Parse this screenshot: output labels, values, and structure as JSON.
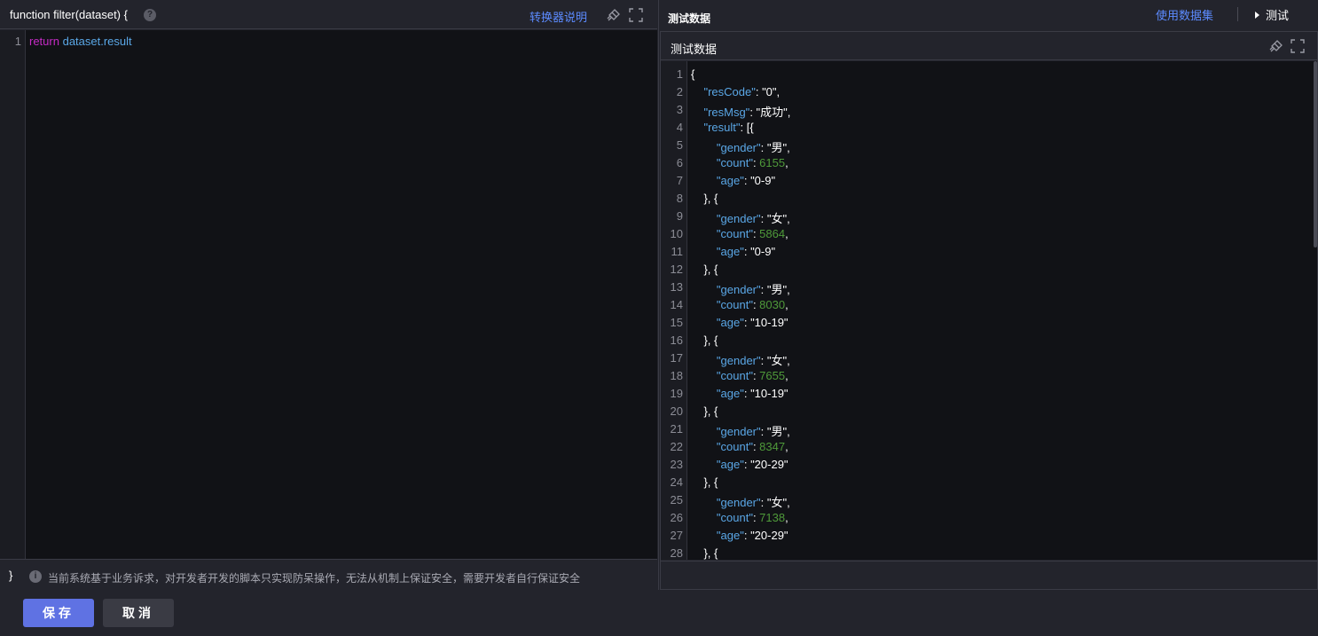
{
  "left": {
    "function_signature": "function filter(dataset) {",
    "help_icon": "?",
    "converter_link": "转换器说明",
    "code": {
      "line_number": "1",
      "keyword": "return",
      "expression": "dataset.result"
    },
    "closing_brace": "}",
    "info_icon": "i",
    "warning_text": "当前系统基于业务诉求，对开发者开发的脚本只实现防呆操作，无法从机制上保证安全，需要开发者自行保证安全"
  },
  "right": {
    "top_title": "测试数据",
    "use_dataset_link": "使用数据集",
    "test_button": "测试",
    "box_title": "测试数据"
  },
  "json_lines": [
    {
      "n": "1",
      "parts": [
        [
          "p",
          "{"
        ]
      ]
    },
    {
      "n": "2",
      "parts": [
        [
          "i",
          "    "
        ],
        [
          "k",
          "\"resCode\""
        ],
        [
          "p",
          ": "
        ],
        [
          "s",
          "\"0\""
        ],
        [
          "p",
          ","
        ]
      ]
    },
    {
      "n": "3",
      "parts": [
        [
          "i",
          "    "
        ],
        [
          "k",
          "\"resMsg\""
        ],
        [
          "p",
          ": "
        ],
        [
          "s",
          "\"成功\""
        ],
        [
          "p",
          ","
        ]
      ]
    },
    {
      "n": "4",
      "parts": [
        [
          "i",
          "    "
        ],
        [
          "k",
          "\"result\""
        ],
        [
          "p",
          ": [{"
        ]
      ]
    },
    {
      "n": "5",
      "parts": [
        [
          "i",
          "        "
        ],
        [
          "k",
          "\"gender\""
        ],
        [
          "p",
          ": "
        ],
        [
          "s",
          "\"男\""
        ],
        [
          "p",
          ","
        ]
      ]
    },
    {
      "n": "6",
      "parts": [
        [
          "i",
          "        "
        ],
        [
          "k",
          "\"count\""
        ],
        [
          "p",
          ": "
        ],
        [
          "n",
          "6155"
        ],
        [
          "p",
          ","
        ]
      ]
    },
    {
      "n": "7",
      "parts": [
        [
          "i",
          "        "
        ],
        [
          "k",
          "\"age\""
        ],
        [
          "p",
          ": "
        ],
        [
          "s",
          "\"0-9\""
        ]
      ]
    },
    {
      "n": "8",
      "parts": [
        [
          "i",
          "    "
        ],
        [
          "p",
          "}, {"
        ]
      ]
    },
    {
      "n": "9",
      "parts": [
        [
          "i",
          "        "
        ],
        [
          "k",
          "\"gender\""
        ],
        [
          "p",
          ": "
        ],
        [
          "s",
          "\"女\""
        ],
        [
          "p",
          ","
        ]
      ]
    },
    {
      "n": "10",
      "parts": [
        [
          "i",
          "        "
        ],
        [
          "k",
          "\"count\""
        ],
        [
          "p",
          ": "
        ],
        [
          "n",
          "5864"
        ],
        [
          "p",
          ","
        ]
      ]
    },
    {
      "n": "11",
      "parts": [
        [
          "i",
          "        "
        ],
        [
          "k",
          "\"age\""
        ],
        [
          "p",
          ": "
        ],
        [
          "s",
          "\"0-9\""
        ]
      ]
    },
    {
      "n": "12",
      "parts": [
        [
          "i",
          "    "
        ],
        [
          "p",
          "}, {"
        ]
      ]
    },
    {
      "n": "13",
      "parts": [
        [
          "i",
          "        "
        ],
        [
          "k",
          "\"gender\""
        ],
        [
          "p",
          ": "
        ],
        [
          "s",
          "\"男\""
        ],
        [
          "p",
          ","
        ]
      ]
    },
    {
      "n": "14",
      "parts": [
        [
          "i",
          "        "
        ],
        [
          "k",
          "\"count\""
        ],
        [
          "p",
          ": "
        ],
        [
          "n",
          "8030"
        ],
        [
          "p",
          ","
        ]
      ]
    },
    {
      "n": "15",
      "parts": [
        [
          "i",
          "        "
        ],
        [
          "k",
          "\"age\""
        ],
        [
          "p",
          ": "
        ],
        [
          "s",
          "\"10-19\""
        ]
      ]
    },
    {
      "n": "16",
      "parts": [
        [
          "i",
          "    "
        ],
        [
          "p",
          "}, {"
        ]
      ]
    },
    {
      "n": "17",
      "parts": [
        [
          "i",
          "        "
        ],
        [
          "k",
          "\"gender\""
        ],
        [
          "p",
          ": "
        ],
        [
          "s",
          "\"女\""
        ],
        [
          "p",
          ","
        ]
      ]
    },
    {
      "n": "18",
      "parts": [
        [
          "i",
          "        "
        ],
        [
          "k",
          "\"count\""
        ],
        [
          "p",
          ": "
        ],
        [
          "n",
          "7655"
        ],
        [
          "p",
          ","
        ]
      ]
    },
    {
      "n": "19",
      "parts": [
        [
          "i",
          "        "
        ],
        [
          "k",
          "\"age\""
        ],
        [
          "p",
          ": "
        ],
        [
          "s",
          "\"10-19\""
        ]
      ]
    },
    {
      "n": "20",
      "parts": [
        [
          "i",
          "    "
        ],
        [
          "p",
          "}, {"
        ]
      ]
    },
    {
      "n": "21",
      "parts": [
        [
          "i",
          "        "
        ],
        [
          "k",
          "\"gender\""
        ],
        [
          "p",
          ": "
        ],
        [
          "s",
          "\"男\""
        ],
        [
          "p",
          ","
        ]
      ]
    },
    {
      "n": "22",
      "parts": [
        [
          "i",
          "        "
        ],
        [
          "k",
          "\"count\""
        ],
        [
          "p",
          ": "
        ],
        [
          "n",
          "8347"
        ],
        [
          "p",
          ","
        ]
      ]
    },
    {
      "n": "23",
      "parts": [
        [
          "i",
          "        "
        ],
        [
          "k",
          "\"age\""
        ],
        [
          "p",
          ": "
        ],
        [
          "s",
          "\"20-29\""
        ]
      ]
    },
    {
      "n": "24",
      "parts": [
        [
          "i",
          "    "
        ],
        [
          "p",
          "}, {"
        ]
      ]
    },
    {
      "n": "25",
      "parts": [
        [
          "i",
          "        "
        ],
        [
          "k",
          "\"gender\""
        ],
        [
          "p",
          ": "
        ],
        [
          "s",
          "\"女\""
        ],
        [
          "p",
          ","
        ]
      ]
    },
    {
      "n": "26",
      "parts": [
        [
          "i",
          "        "
        ],
        [
          "k",
          "\"count\""
        ],
        [
          "p",
          ": "
        ],
        [
          "n",
          "7138"
        ],
        [
          "p",
          ","
        ]
      ]
    },
    {
      "n": "27",
      "parts": [
        [
          "i",
          "        "
        ],
        [
          "k",
          "\"age\""
        ],
        [
          "p",
          ": "
        ],
        [
          "s",
          "\"20-29\""
        ]
      ]
    },
    {
      "n": "28",
      "parts": [
        [
          "i",
          "    "
        ],
        [
          "p",
          "}, {"
        ]
      ]
    }
  ],
  "buttons": {
    "save": "保存",
    "cancel": "取消"
  },
  "colors": {
    "accent": "#5f72e3",
    "link": "#5c8bff",
    "keyword": "#c52bc5",
    "json_key": "#5aa7e6",
    "json_number": "#4f9a3a",
    "editor_bg": "#111216"
  },
  "icons": [
    "help-icon",
    "clear-icon",
    "fullscreen-icon",
    "info-icon",
    "play-icon"
  ]
}
